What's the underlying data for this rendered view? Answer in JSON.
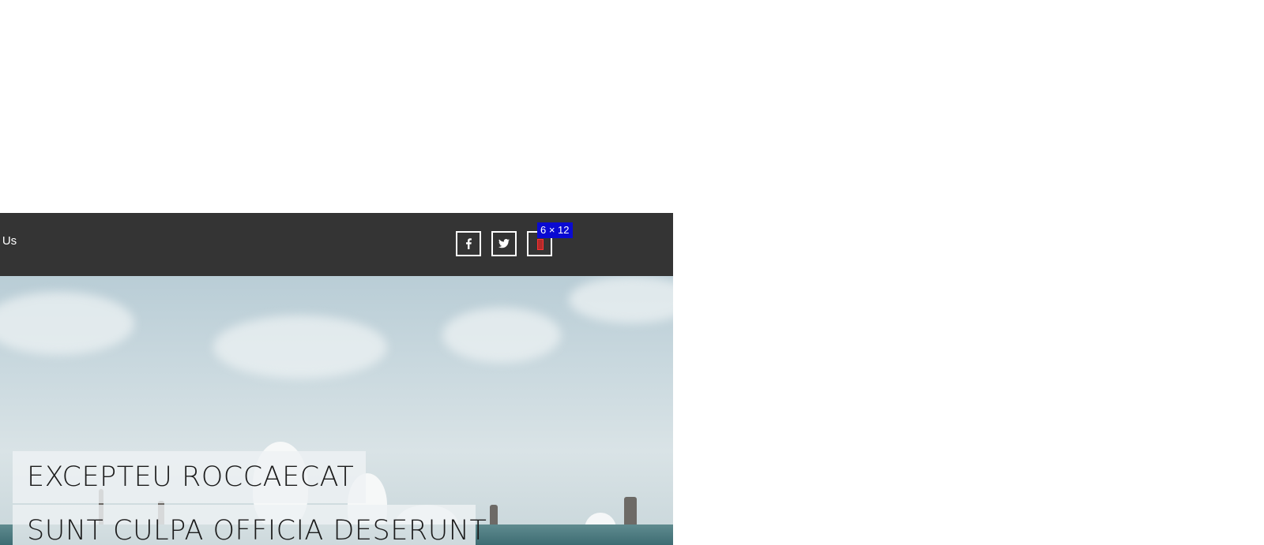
{
  "nav": {
    "contact_label": "ct Us"
  },
  "social": {
    "facebook_icon": "facebook-icon",
    "twitter_icon": "twitter-icon",
    "rss_icon": "rss-icon"
  },
  "inspector": {
    "size_label": "6 × 12"
  },
  "hero": {
    "caption_line_1": "EXCEPTEU ROCCAECAT",
    "caption_line_2": "SUNT CULPA OFFICIA DESERUNT"
  },
  "colors": {
    "navbar": "#343434",
    "inspector_tip": "#0a0ad2",
    "inspector_box": "#ff3131"
  }
}
